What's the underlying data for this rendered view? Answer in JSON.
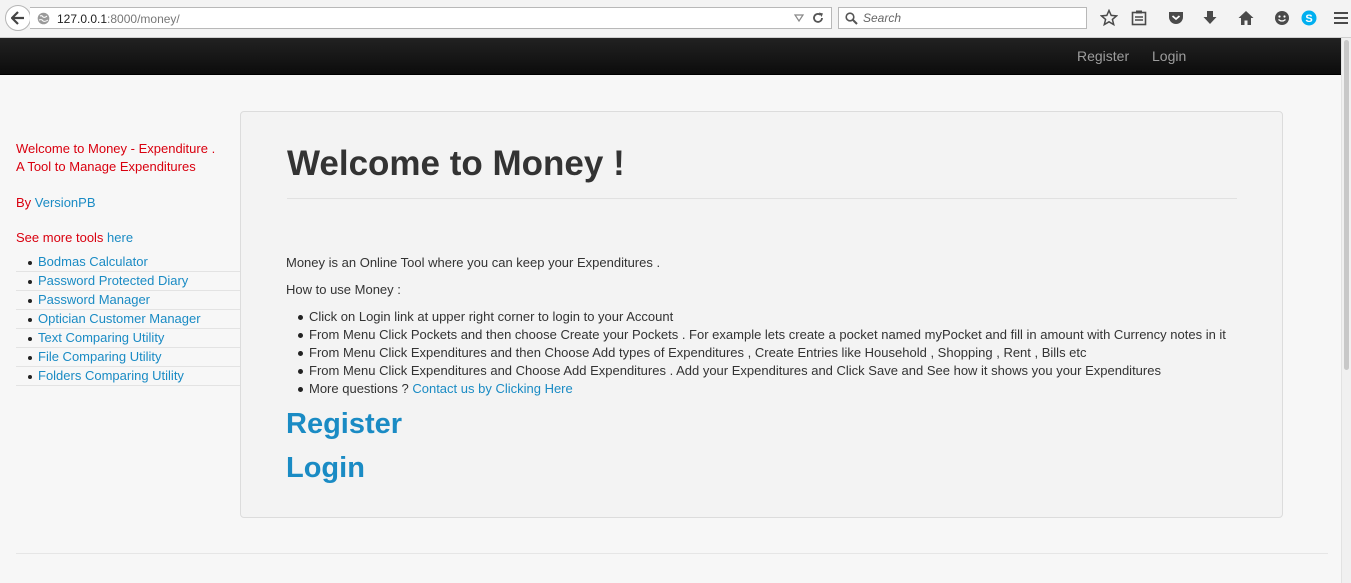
{
  "browser": {
    "url_host": "127.0.0.1",
    "url_rest": ":8000/money/",
    "search_placeholder": "Search"
  },
  "navbar": {
    "register_label": "Register",
    "login_label": "Login"
  },
  "sidebar": {
    "welcome_line1": "Welcome to Money - Expenditure .",
    "welcome_line2": "A Tool to Manage Expenditures",
    "by_prefix": "By ",
    "by_link": "VersionPB",
    "more_tools_prefix": "See more tools ",
    "more_tools_link": "here",
    "tools": [
      {
        "label": "Bodmas Calculator"
      },
      {
        "label": "Password Protected Diary"
      },
      {
        "label": "Password Manager"
      },
      {
        "label": "Optician Customer Manager"
      },
      {
        "label": "Text Comparing Utility"
      },
      {
        "label": "File Comparing Utility"
      },
      {
        "label": "Folders Comparing Utility"
      }
    ]
  },
  "main": {
    "title": "Welcome to Money !",
    "intro": "Money is an Online Tool where you can keep your Expenditures .",
    "howto": "How to use Money :",
    "steps": [
      "Click on Login link at upper right corner to login to your Account",
      "From Menu Click Pockets and then choose Create your Pockets . For example lets create a pocket named myPocket and fill in amount with Currency notes in it",
      "From Menu Click Expenditures and then Choose Add types of Expenditures , Create Entries like Household , Shopping , Rent , Bills etc",
      "From Menu Click Expenditures and Choose Add Expenditures . Add your Expenditures and Click Save and See how it shows you your Expenditures"
    ],
    "questions_prefix": "More questions ? ",
    "contact_link": "Contact us by Clicking Here",
    "register_link": "Register",
    "login_link": "Login"
  },
  "colors": {
    "accent_link": "#1a8bc4",
    "sidebar_red": "#d9000f",
    "navbar_bg": "#111111"
  }
}
